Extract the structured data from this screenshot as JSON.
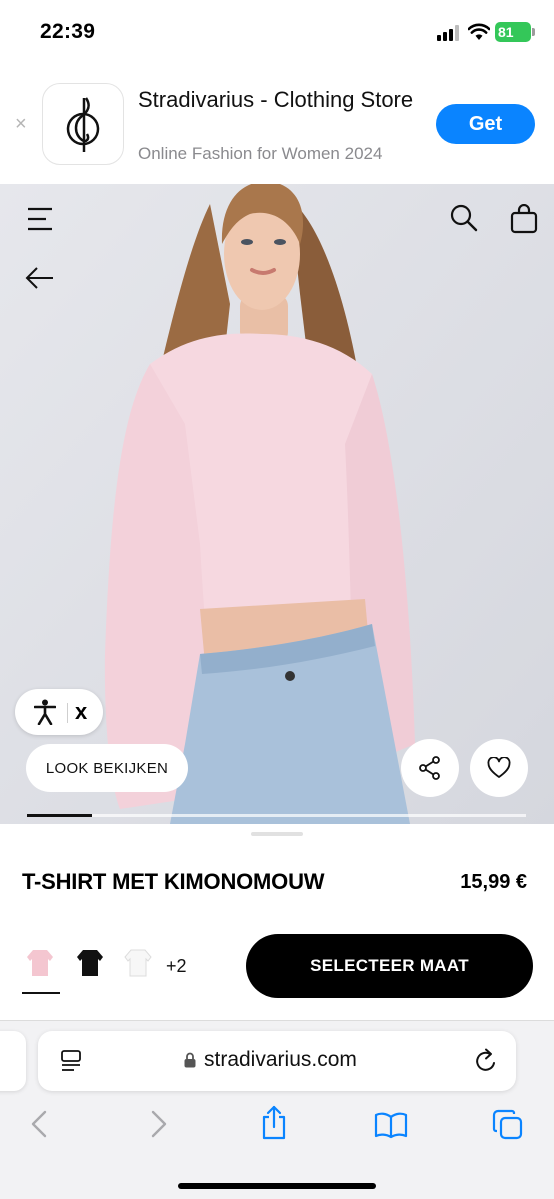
{
  "status_bar": {
    "time": "22:39",
    "battery": "81"
  },
  "app_banner": {
    "close_symbol": "×",
    "app_name": "Stradivarius - Clothing Store",
    "subtitle": "Online Fashion for Women 2024",
    "get_label": "Get",
    "get_color": "#0a84ff"
  },
  "hero": {
    "icons": [
      "menu-icon",
      "search-icon",
      "shopping-bag-icon",
      "back-arrow-icon",
      "accessibility-icon",
      "share-icon",
      "heart-icon"
    ],
    "accessibility_close": "x",
    "look_label": "LOOK BEKIJKEN",
    "gallery_progress": 0.13
  },
  "product": {
    "name": "T-SHIRT MET KIMONOMOUW",
    "price": "15,99 €",
    "colors": [
      {
        "name": "pink",
        "hex": "#f4c6d0",
        "selected": true
      },
      {
        "name": "black",
        "hex": "#111111",
        "selected": false
      },
      {
        "name": "white",
        "hex": "#f5f5f5",
        "selected": false
      }
    ],
    "more_colors": "+2",
    "select_size_label": "SELECTEER MAAT"
  },
  "browser": {
    "url": "stradivarius.com",
    "accent": "#0a84ff",
    "toolbar": [
      "back-icon",
      "forward-icon",
      "share-icon",
      "bookmarks-icon",
      "tabs-icon"
    ]
  }
}
